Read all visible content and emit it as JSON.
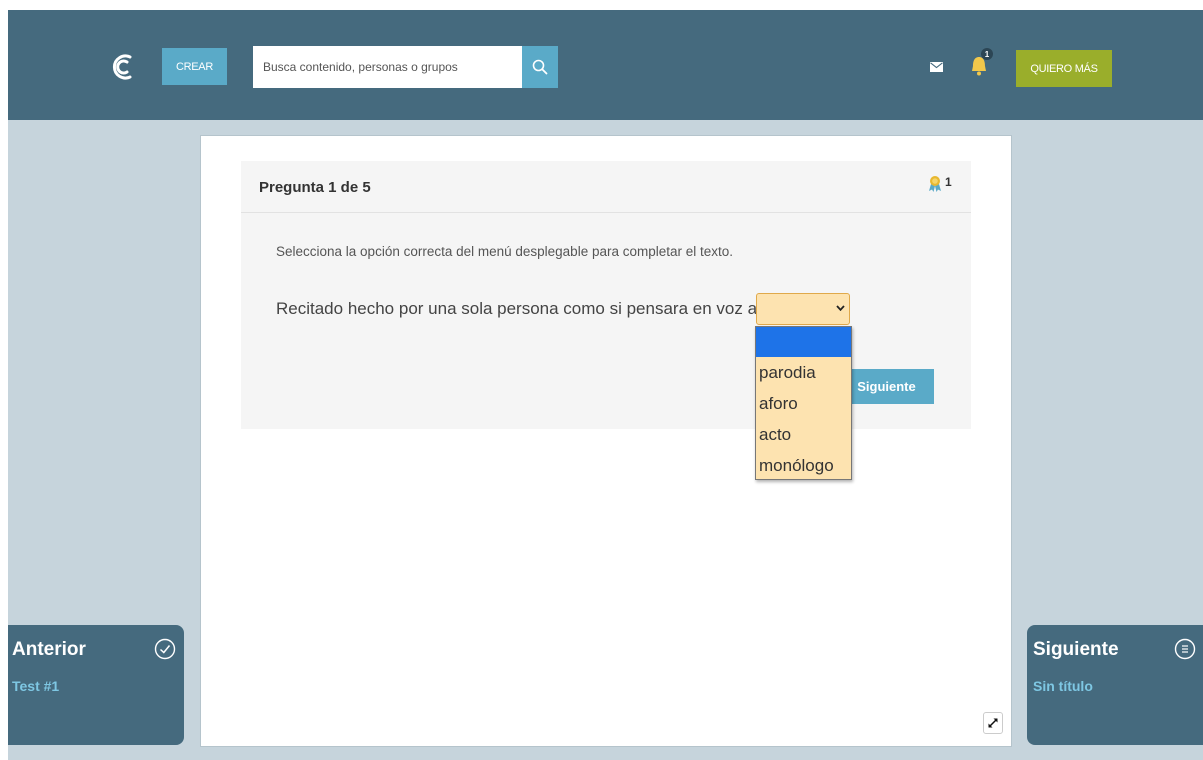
{
  "header": {
    "create_label": "CREAR",
    "search_placeholder": "Busca contenido, personas o grupos",
    "notification_count": "1",
    "upgrade_label": "QUIERO MÁS"
  },
  "quiz": {
    "question_title": "Pregunta 1 de 5",
    "points": "1",
    "instructions": "Selecciona la opción correcta del menú desplegable para completar el texto.",
    "sentence": "Recitado hecho por una sola persona como si pensara en voz alta.",
    "select_value": "",
    "options": [
      "",
      "parodia",
      "aforo",
      "acto",
      "monólogo"
    ],
    "next_label": "Siguiente"
  },
  "nav": {
    "prev_title": "Anterior",
    "prev_sub": "Test #1",
    "next_title": "Siguiente",
    "next_sub": "Sin título"
  },
  "colors": {
    "topbar": "#456a7e",
    "accent_blue": "#5aaac8",
    "accent_green": "#9aae2b",
    "select_bg": "#fde3b0",
    "selected_option": "#1e73e8"
  }
}
